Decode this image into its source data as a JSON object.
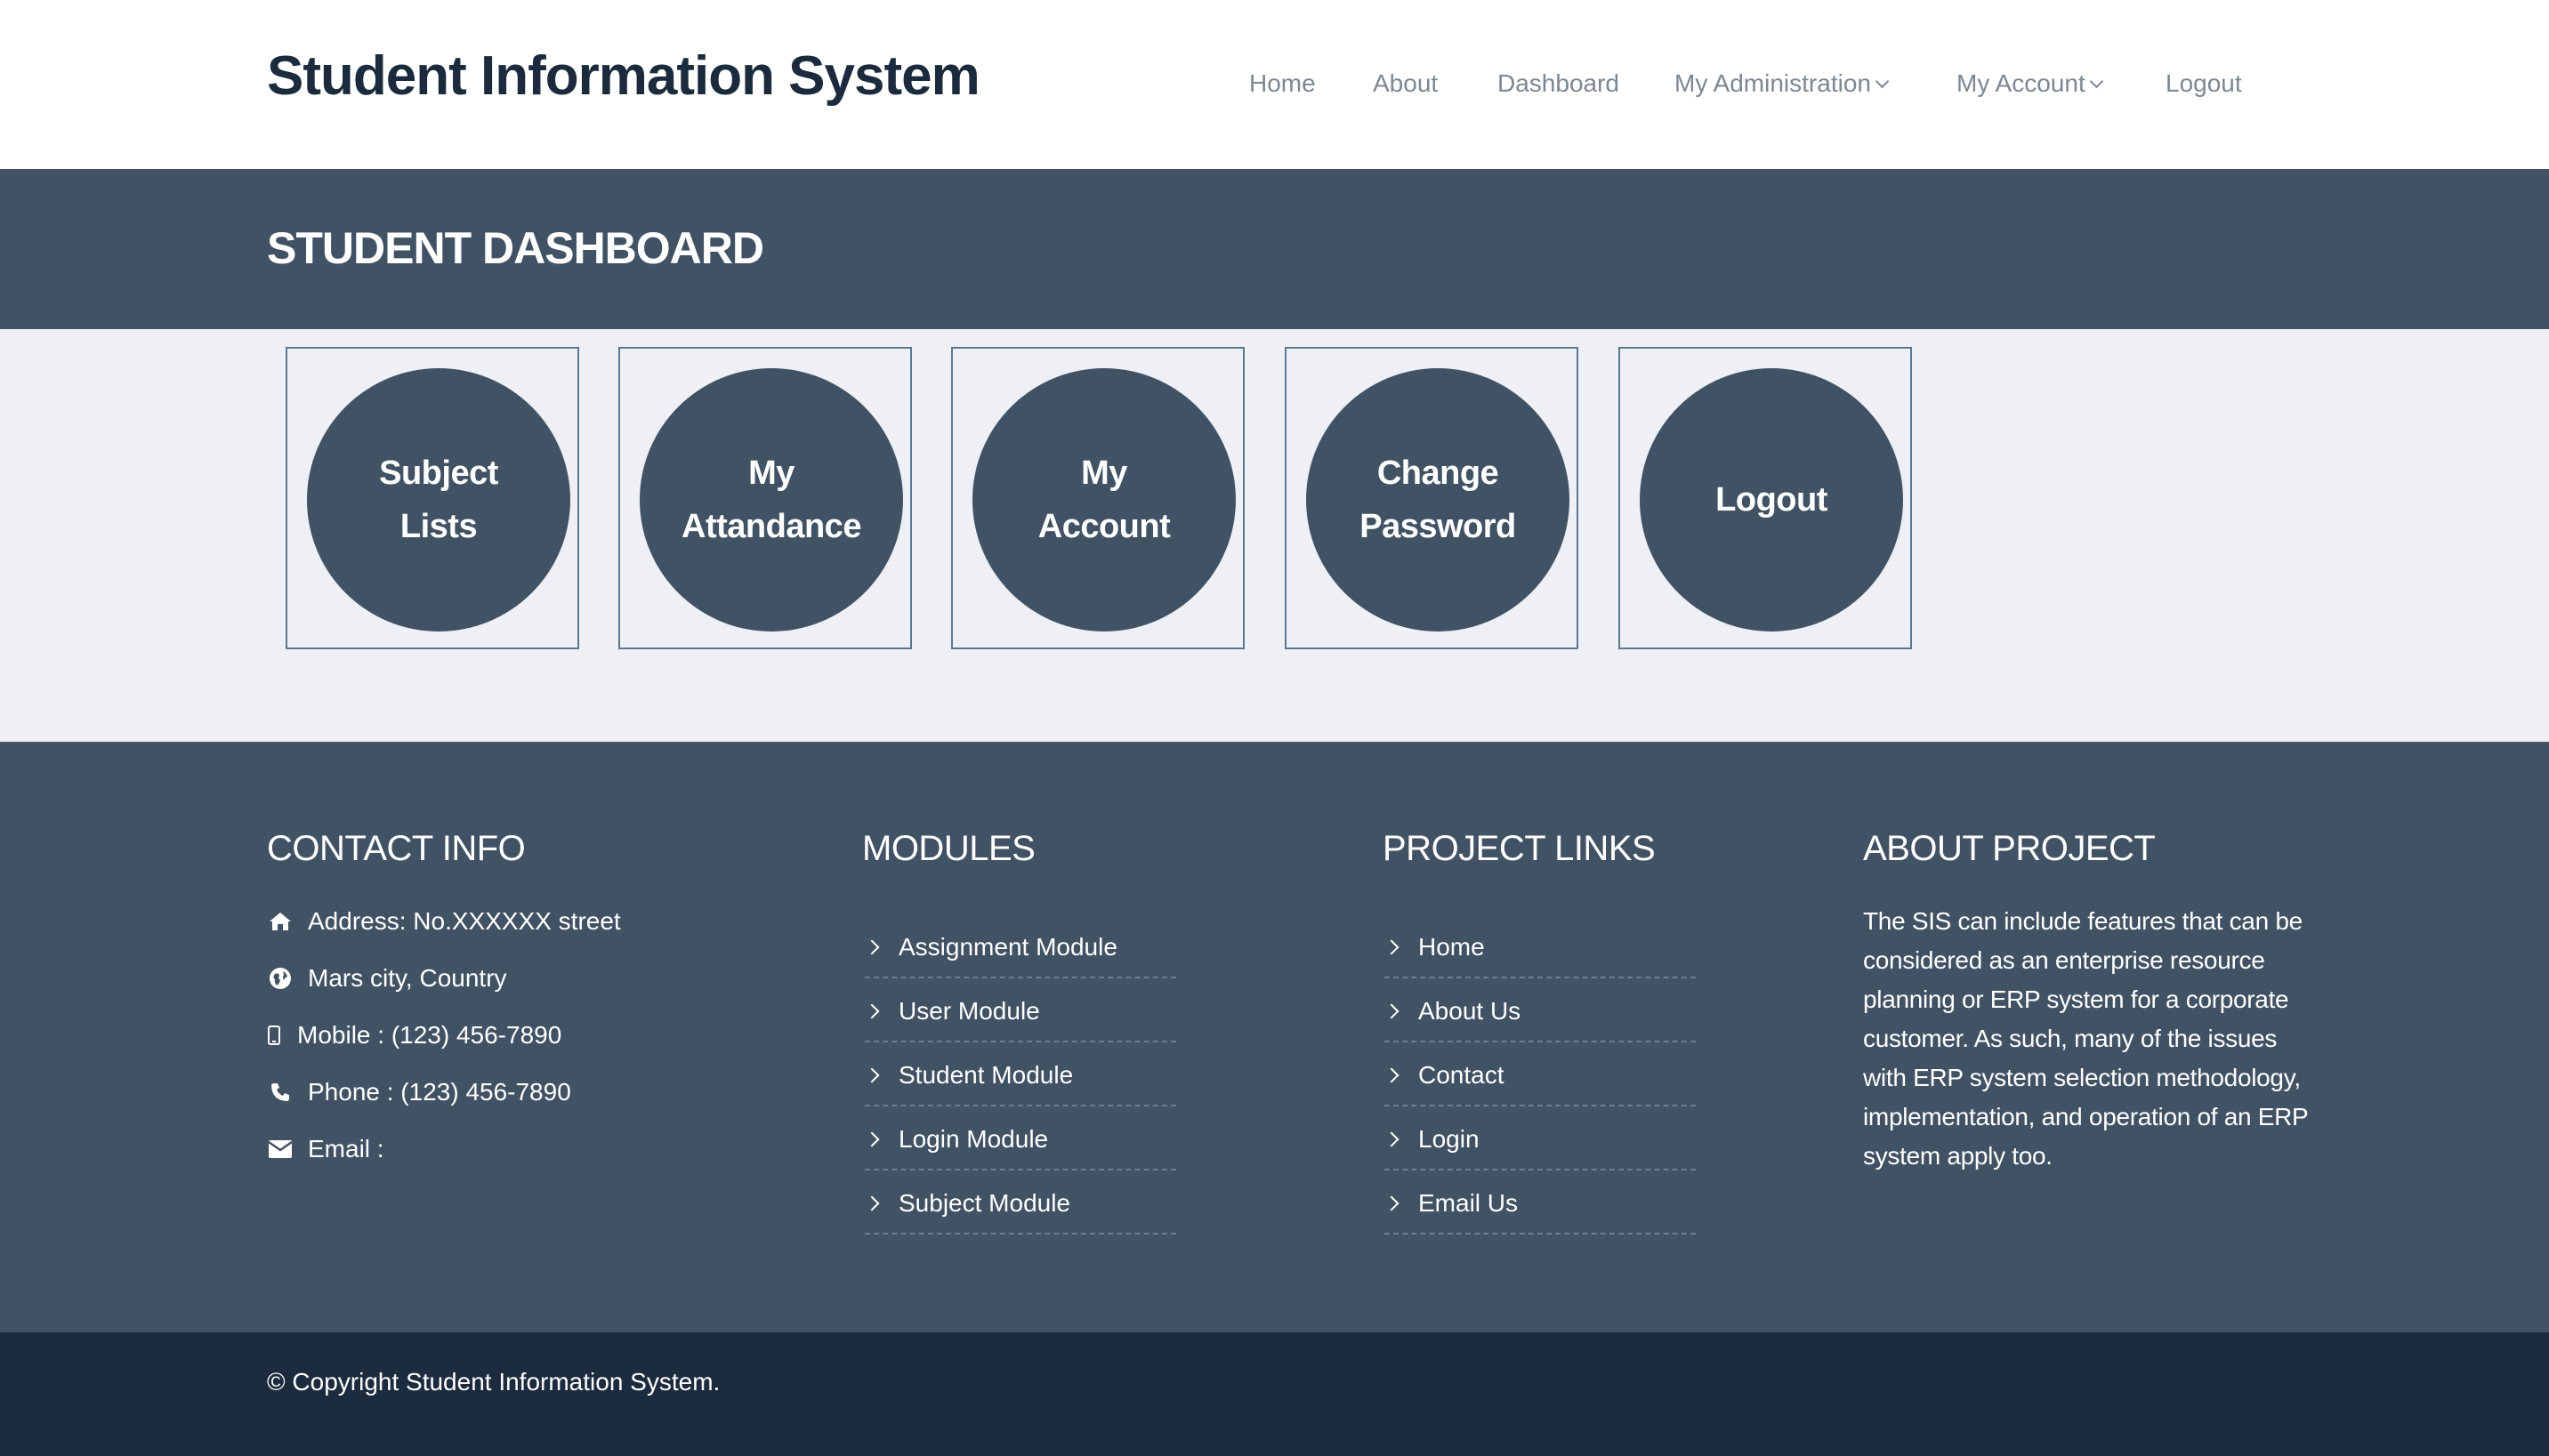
{
  "header": {
    "brand": "Student Information System",
    "nav": [
      {
        "label": "Home",
        "dropdown": false
      },
      {
        "label": "About",
        "dropdown": false
      },
      {
        "label": "Dashboard",
        "dropdown": false
      },
      {
        "label": "My Administration",
        "dropdown": true
      },
      {
        "label": "My Account",
        "dropdown": true
      },
      {
        "label": "Logout",
        "dropdown": false
      }
    ]
  },
  "page": {
    "title": "STUDENT DASHBOARD"
  },
  "tiles": [
    {
      "line1": "Subject",
      "line2": "Lists"
    },
    {
      "line1": "My",
      "line2": "Attandance"
    },
    {
      "line1": "My",
      "line2": "Account"
    },
    {
      "line1": "Change",
      "line2": "Password"
    },
    {
      "line1": "Logout",
      "line2": ""
    }
  ],
  "footer": {
    "contact": {
      "heading": "CONTACT INFO",
      "rows": [
        {
          "icon": "home-icon",
          "text": "Address: No.XXXXXX street"
        },
        {
          "icon": "globe-icon",
          "text": "Mars city, Country"
        },
        {
          "icon": "mobile-icon",
          "text": "Mobile : (123) 456-7890"
        },
        {
          "icon": "phone-icon",
          "text": "Phone : (123) 456-7890"
        },
        {
          "icon": "envelope-icon",
          "text": "Email :"
        }
      ]
    },
    "modules": {
      "heading": "MODULES",
      "items": [
        "Assignment Module",
        "User Module",
        "Student Module",
        "Login Module",
        "Subject Module"
      ]
    },
    "project_links": {
      "heading": "PROJECT LINKS",
      "items": [
        "Home",
        "About Us",
        "Contact",
        "Login",
        "Email Us"
      ]
    },
    "about": {
      "heading": "ABOUT PROJECT",
      "text": "The SIS can include features that can be considered as an enterprise resource planning or ERP system for a corporate customer. As such, many of the issues with ERP system selection methodology, implementation, and operation of an ERP system apply too."
    }
  },
  "copyright": "© Copyright Student Information System.",
  "colors": {
    "primary": "#415265",
    "dark": "#1c2b3e",
    "light_bg": "#eef0f6",
    "nav_text": "#7d8792",
    "brand_text": "#1b2a3c"
  }
}
